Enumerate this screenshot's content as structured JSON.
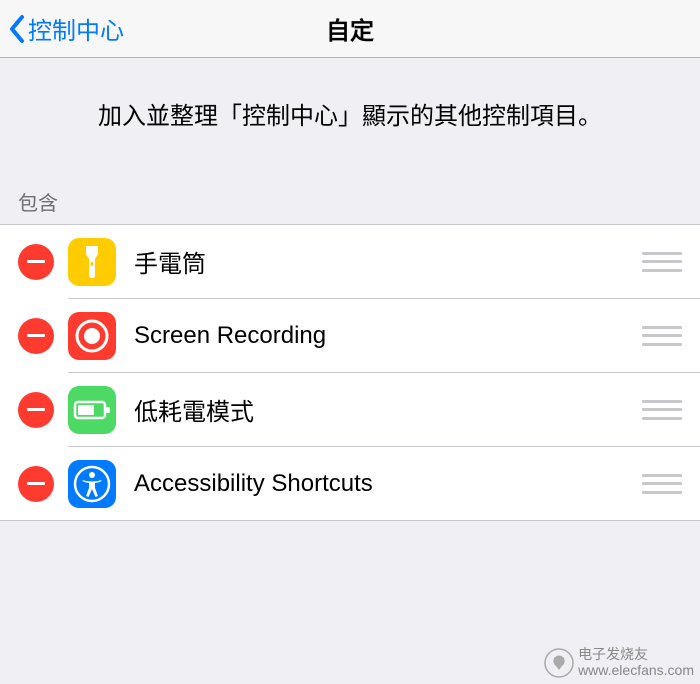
{
  "nav": {
    "back_label": "控制中心",
    "title": "自定"
  },
  "description": "加入並整理「控制中心」顯示的其他控制項目。",
  "section_header": "包含",
  "rows": [
    {
      "label": "手電筒",
      "icon": "flashlight"
    },
    {
      "label": "Screen Recording",
      "icon": "recording"
    },
    {
      "label": "低耗電模式",
      "icon": "lowpower"
    },
    {
      "label": "Accessibility Shortcuts",
      "icon": "accessibility"
    }
  ],
  "watermark": {
    "line1": "电子发烧友",
    "line2": "www.elecfans.com"
  }
}
